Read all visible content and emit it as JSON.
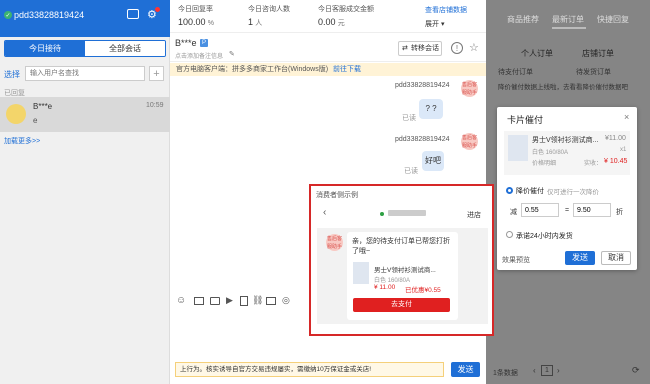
{
  "left": {
    "account": "pdd33828819424",
    "tabs": [
      "今日接待",
      "全部会话"
    ],
    "select_label": "选择",
    "search_placeholder": "输入用户名查找",
    "section_label": "已回复",
    "conversation": {
      "name": "B***e",
      "time": "10:59",
      "preview": "e"
    },
    "load_more": "加载更多>>"
  },
  "stats": {
    "items": [
      {
        "label": "今日回复率",
        "value": "100.00",
        "unit": "%"
      },
      {
        "label": "今日咨询人数",
        "value": "1",
        "unit": "人"
      },
      {
        "label": "今日客服成交金额",
        "value": "0.00",
        "unit": "元"
      }
    ],
    "link": "查看店铺数据",
    "expand": "展开"
  },
  "chat": {
    "name": "B***e",
    "badge": "P",
    "note": "点击添加备注信息",
    "transfer": "转移会话",
    "notice": "官方电脑客户端：拼多多商家工作台(Windows版)",
    "notice_link": "前往下载",
    "messages": [
      {
        "sender": "pdd33828819424",
        "text": "? ?",
        "status": "已读",
        "avatar": "售后客服助手"
      },
      {
        "sender": "pdd33828819424",
        "text": "好吧",
        "status": "已读",
        "avatar": "售后客服助手"
      }
    ],
    "bottom_text": "上行为。核实诱导自官方交易违规屡实，需缴纳10万保证金或关店!",
    "send": "发送"
  },
  "example": {
    "title": "消费者侧示例",
    "header_right": "进店",
    "msg": "亲，您的待支付订单已帮您打折了哦~",
    "product": "男士V领衬衫测试商...",
    "spec": "白色 160/80A",
    "price": "¥ 11.00",
    "discount": "已优惠¥0.55",
    "pay": "去支付",
    "avatar": "售后客服助手"
  },
  "right": {
    "tabs": [
      "商品推荐",
      "最新订单",
      "快捷回复"
    ],
    "subtabs": [
      "个人订单",
      "店铺订单"
    ],
    "order_tabs": [
      "待支付订单",
      "待发货订单"
    ],
    "banner": "降价催付数据上线啦，去看看降价催付数据吧",
    "pagination": "1条数据",
    "page": "1"
  },
  "popup": {
    "title": "卡片催付",
    "product": "男士V领衬衫测试商...",
    "price": "¥11.00",
    "spec": "白色 160/80A",
    "qty": "x1",
    "detail": "价格明细",
    "pay_label": "实收：",
    "pay_value": "¥ 10.45",
    "option1": "降价催付",
    "option1_note": "仅可进行一次降价",
    "discount_label": "减",
    "discount_value": "0.55",
    "equals": "=",
    "result_value": "9.50",
    "unit": "折",
    "option2": "承诺24小时内发货",
    "preview": "效果预览",
    "send": "发送",
    "cancel": "取消"
  }
}
